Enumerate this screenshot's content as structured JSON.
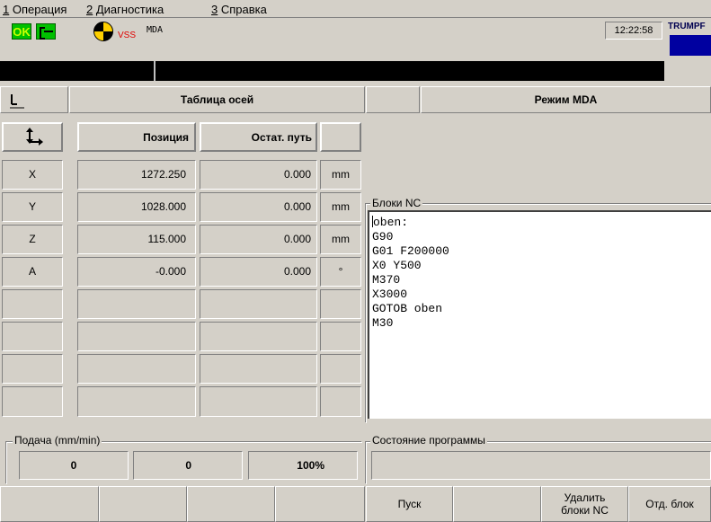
{
  "menu": [
    {
      "num": "1",
      "label": " Операция"
    },
    {
      "num": "2",
      "label": " Диагностика"
    },
    {
      "num": "3",
      "label": " Справка"
    }
  ],
  "status": {
    "ok_label": "OK",
    "vss_label": "VSS",
    "mode_small": "MDA",
    "time": "12:22:58",
    "brand": "TRUMPF"
  },
  "headers": {
    "axis_table": "Таблица осей",
    "mode": "Режим MDA"
  },
  "columns": {
    "position": "Позиция",
    "remaining": "Остат. путь"
  },
  "axes": [
    {
      "name": "X",
      "position": "1272.250",
      "remaining": "0.000",
      "unit": "mm"
    },
    {
      "name": "Y",
      "position": "1028.000",
      "remaining": "0.000",
      "unit": "mm"
    },
    {
      "name": "Z",
      "position": "115.000",
      "remaining": "0.000",
      "unit": "mm"
    },
    {
      "name": "A",
      "position": "-0.000",
      "remaining": "0.000",
      "unit": "°"
    }
  ],
  "nc": {
    "group_label": "Блоки NC",
    "lines": [
      "oben:",
      "G90",
      "G01 F200000",
      "X0 Y500",
      "M370",
      "X3000",
      "GOTOB oben",
      "M30"
    ]
  },
  "feed": {
    "group_label": "Подача (mm/min)",
    "value1": "0",
    "value2": "0",
    "percent": "100%"
  },
  "program_state": {
    "group_label": "Состояние программы",
    "value": ""
  },
  "softkeys": {
    "start": "Пуск",
    "delete_nc_line1": "Удалить",
    "delete_nc_line2": "блоки NC",
    "single_block": "Отд. блок"
  },
  "colors": {
    "panel": "#d4d0c8",
    "ok_green": "#00c000",
    "vss_red": "#e00000",
    "brand_blue": "#0000a0"
  },
  "icons": {
    "ok": "ok-status-icon",
    "door": "door-icon",
    "target": "target-icon",
    "axes": "axes-icon",
    "coordinate": "coordinate-icon"
  }
}
